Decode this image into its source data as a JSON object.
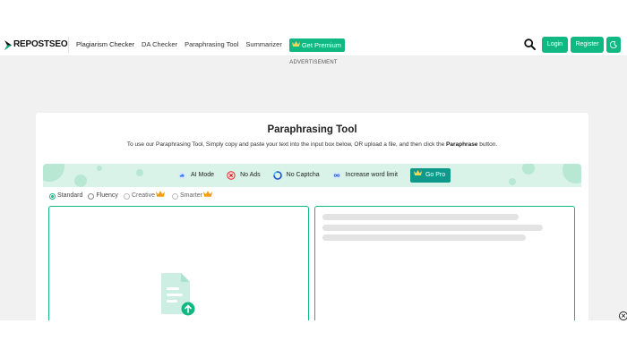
{
  "brand": {
    "logo_text": "REPOSTSEO"
  },
  "nav": {
    "items": [
      "Plagiarism Checker",
      "DA Checker",
      "Paraphrasing Tool",
      "Summarizer"
    ],
    "premium_label": "Get Premium"
  },
  "header_actions": {
    "login_label": "Login",
    "register_label": "Register"
  },
  "advertisement_label": "ADVERTISEMENT",
  "tool": {
    "title": "Paraphrasing Tool",
    "subtitle_prefix": "To use our Paraphrasing Tool, Simply copy and paste your text into the input box below, OR upload a file, and then click the ",
    "subtitle_bold": "Paraphrase",
    "subtitle_suffix": " button."
  },
  "features": {
    "items": [
      {
        "label": "AI Mode",
        "icon": "ai-mode-icon"
      },
      {
        "label": "No Ads",
        "icon": "no-ads-icon"
      },
      {
        "label": "No Captcha",
        "icon": "no-captcha-icon"
      },
      {
        "label": "Increase word limit",
        "icon": "infinity-icon"
      }
    ],
    "gopro_label": "Go Pro"
  },
  "modes": {
    "items": [
      {
        "label": "Standard",
        "selected": true,
        "premium": false
      },
      {
        "label": "Fluency",
        "selected": false,
        "premium": false
      },
      {
        "label": "Creative",
        "selected": false,
        "premium": true
      },
      {
        "label": "Smarter",
        "selected": false,
        "premium": true
      }
    ]
  },
  "colors": {
    "accent": "#10b981",
    "gopro": "#0d9a8a",
    "feature_bar": "#d9f3e9",
    "page_bg": "#f1f1f1"
  },
  "close_label": "×"
}
